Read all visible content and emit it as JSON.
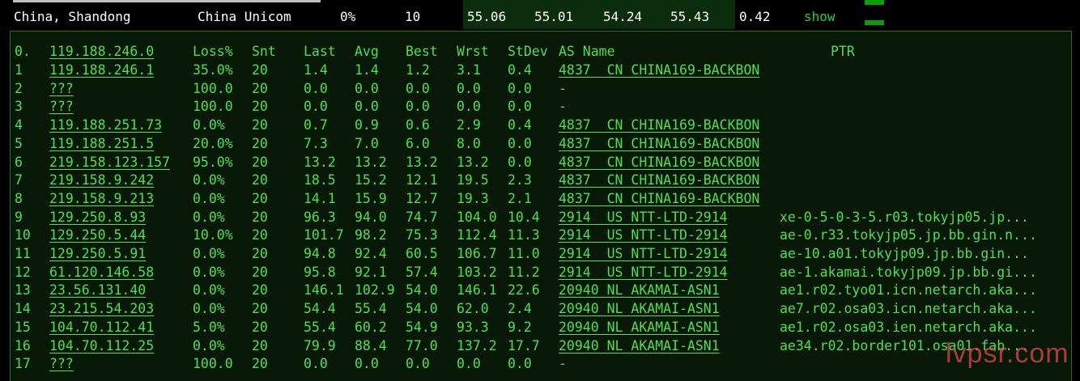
{
  "summary": {
    "location": "China, Shandong",
    "isp": "China Unicom",
    "loss": "0%",
    "sent": "10",
    "last": "55.06",
    "avg": "55.01",
    "best": "54.24",
    "worst": "55.43",
    "stdev": "0.42",
    "action": "show"
  },
  "headers": {
    "idx": "0.",
    "host": "119.188.246.0",
    "loss": "Loss%",
    "snt": "Snt",
    "last": "Last",
    "avg": "Avg",
    "best": "Best",
    "wrst": "Wrst",
    "stdev": "StDev",
    "as": "AS Name",
    "ptr": "PTR"
  },
  "hops": [
    {
      "n": "1",
      "host": "119.188.246.1",
      "loss": "35.0%",
      "snt": "20",
      "last": "1.4",
      "avg": "1.4",
      "best": "1.2",
      "wrst": "3.1",
      "stdev": "0.4",
      "as": "4837  CN CHINA169-BACKBON",
      "ptr": ""
    },
    {
      "n": "2",
      "host": "???",
      "loss": "100.0",
      "snt": "20",
      "last": "0.0",
      "avg": "0.0",
      "best": "0.0",
      "wrst": "0.0",
      "stdev": "0.0",
      "as": "-",
      "ptr": ""
    },
    {
      "n": "3",
      "host": "???",
      "loss": "100.0",
      "snt": "20",
      "last": "0.0",
      "avg": "0.0",
      "best": "0.0",
      "wrst": "0.0",
      "stdev": "0.0",
      "as": "-",
      "ptr": ""
    },
    {
      "n": "4",
      "host": "119.188.251.73",
      "loss": "0.0%",
      "snt": "20",
      "last": "0.7",
      "avg": "0.9",
      "best": "0.6",
      "wrst": "2.9",
      "stdev": "0.4",
      "as": "4837  CN CHINA169-BACKBON",
      "ptr": ""
    },
    {
      "n": "5",
      "host": "119.188.251.5",
      "loss": "20.0%",
      "snt": "20",
      "last": "7.3",
      "avg": "7.0",
      "best": "6.0",
      "wrst": "8.0",
      "stdev": "0.0",
      "as": "4837  CN CHINA169-BACKBON",
      "ptr": ""
    },
    {
      "n": "6",
      "host": "219.158.123.157",
      "loss": "95.0%",
      "snt": "20",
      "last": "13.2",
      "avg": "13.2",
      "best": "13.2",
      "wrst": "13.2",
      "stdev": "0.0",
      "as": "4837  CN CHINA169-BACKBON",
      "ptr": ""
    },
    {
      "n": "7",
      "host": "219.158.9.242",
      "loss": "0.0%",
      "snt": "20",
      "last": "18.5",
      "avg": "15.2",
      "best": "12.1",
      "wrst": "19.5",
      "stdev": "2.3",
      "as": "4837  CN CHINA169-BACKBON",
      "ptr": ""
    },
    {
      "n": "8",
      "host": "219.158.9.213",
      "loss": "0.0%",
      "snt": "20",
      "last": "14.1",
      "avg": "15.9",
      "best": "12.7",
      "wrst": "19.3",
      "stdev": "2.1",
      "as": "4837  CN CHINA169-BACKBON",
      "ptr": ""
    },
    {
      "n": "9",
      "host": "129.250.8.93",
      "loss": "0.0%",
      "snt": "20",
      "last": "96.3",
      "avg": "94.0",
      "best": "74.7",
      "wrst": "104.0",
      "stdev": "10.4",
      "as": "2914  US NTT-LTD-2914",
      "ptr": "xe-0-5-0-3-5.r03.tokyjp05.jp..."
    },
    {
      "n": "10",
      "host": "129.250.5.44",
      "loss": "10.0%",
      "snt": "20",
      "last": "101.7",
      "avg": "98.2",
      "best": "75.3",
      "wrst": "112.4",
      "stdev": "11.3",
      "as": "2914  US NTT-LTD-2914",
      "ptr": "ae-0.r33.tokyjp05.jp.bb.gin.n..."
    },
    {
      "n": "11",
      "host": "129.250.5.91",
      "loss": "0.0%",
      "snt": "20",
      "last": "94.8",
      "avg": "92.4",
      "best": "60.5",
      "wrst": "106.7",
      "stdev": "11.0",
      "as": "2914  US NTT-LTD-2914",
      "ptr": "ae-10.a01.tokyjp09.jp.bb.gin..."
    },
    {
      "n": "12",
      "host": "61.120.146.58",
      "loss": "0.0%",
      "snt": "20",
      "last": "95.8",
      "avg": "92.1",
      "best": "57.4",
      "wrst": "103.2",
      "stdev": "11.2",
      "as": "2914  US NTT-LTD-2914",
      "ptr": "ae-1.akamai.tokyjp09.jp.bb.gi..."
    },
    {
      "n": "13",
      "host": "23.56.131.40",
      "loss": "0.0%",
      "snt": "20",
      "last": "146.1",
      "avg": "102.9",
      "best": "54.0",
      "wrst": "146.1",
      "stdev": "22.6",
      "as": "20940 NL AKAMAI-ASN1",
      "ptr": "ae1.r02.tyo01.icn.netarch.aka..."
    },
    {
      "n": "14",
      "host": "23.215.54.203",
      "loss": "0.0%",
      "snt": "20",
      "last": "54.4",
      "avg": "55.4",
      "best": "54.0",
      "wrst": "62.0",
      "stdev": "2.4",
      "as": "20940 NL AKAMAI-ASN1",
      "ptr": "ae7.r02.osa03.icn.netarch.aka..."
    },
    {
      "n": "15",
      "host": "104.70.112.41",
      "loss": "5.0%",
      "snt": "20",
      "last": "55.4",
      "avg": "60.2",
      "best": "54.9",
      "wrst": "93.3",
      "stdev": "9.2",
      "as": "20940 NL AKAMAI-ASN1",
      "ptr": "ae1.r02.osa03.ien.netarch.aka..."
    },
    {
      "n": "16",
      "host": "104.70.112.25",
      "loss": "0.0%",
      "snt": "20",
      "last": "79.9",
      "avg": "88.4",
      "best": "77.0",
      "wrst": "137.2",
      "stdev": "17.7",
      "as": "20940 NL AKAMAI-ASN1",
      "ptr": "ae34.r02.border101.osa01.fab..."
    },
    {
      "n": "17",
      "host": "???",
      "loss": "100.0",
      "snt": "20",
      "last": "0.0",
      "avg": "0.0",
      "best": "0.0",
      "wrst": "0.0",
      "stdev": "0.0",
      "as": "-",
      "ptr": ""
    }
  ],
  "watermark": "lvpsr.com"
}
